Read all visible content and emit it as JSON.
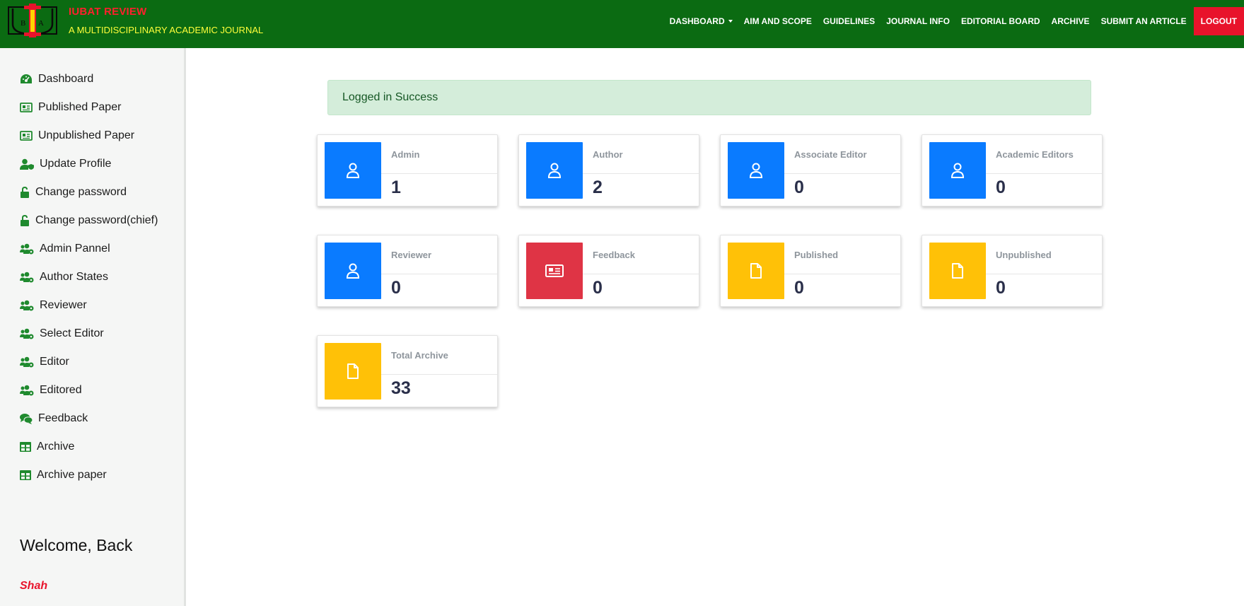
{
  "header": {
    "logo_letters": [
      "I",
      "U",
      "B",
      "A",
      "T"
    ],
    "title": "IUBAT REVIEW",
    "subtitle": "A MULTIDISCIPLINARY ACADEMIC JOURNAL",
    "nav": [
      {
        "label": "DASHBOARD",
        "dropdown": true
      },
      {
        "label": "AIM AND SCOPE"
      },
      {
        "label": "GUIDELINES"
      },
      {
        "label": "JOURNAL INFO"
      },
      {
        "label": "EDITORIAL BOARD"
      },
      {
        "label": "ARCHIVE"
      },
      {
        "label": "SUBMIT AN ARTICLE"
      }
    ],
    "logout_label": "LOGOUT"
  },
  "colors": {
    "header_bg": "#0b6b12",
    "brand_title": "#ff1f2d",
    "brand_sub": "#ffff3a",
    "logout_bg": "#e8132b",
    "sidebar_icon": "#1f8a2e",
    "blue": "#0a7bff",
    "red": "#df3445",
    "yellow": "#ffc107"
  },
  "sidebar": {
    "items": [
      {
        "label": "Dashboard",
        "icon": "tachometer-icon"
      },
      {
        "label": "Published Paper",
        "icon": "newspaper-icon"
      },
      {
        "label": "Unpublished Paper",
        "icon": "newspaper-icon"
      },
      {
        "label": "Update Profile",
        "icon": "user-shield-icon"
      },
      {
        "label": "Change password",
        "icon": "lock-open-icon"
      },
      {
        "label": "Change password(chief)",
        "icon": "lock-open-icon"
      },
      {
        "label": "Admin Pannel",
        "icon": "users-cog-icon"
      },
      {
        "label": "Author States",
        "icon": "users-cog-icon"
      },
      {
        "label": "Reviewer",
        "icon": "users-cog-icon"
      },
      {
        "label": "Select Editor",
        "icon": "users-cog-icon"
      },
      {
        "label": "Editor",
        "icon": "users-cog-icon"
      },
      {
        "label": "Editored",
        "icon": "users-cog-icon"
      },
      {
        "label": "Feedback",
        "icon": "comments-icon"
      },
      {
        "label": "Archive",
        "icon": "table-icon"
      },
      {
        "label": "Archive paper",
        "icon": "table-icon"
      }
    ],
    "welcome": "Welcome, Back",
    "username": "Shah"
  },
  "main": {
    "alert": "Logged in Success",
    "cards": [
      {
        "label": "Admin",
        "value": "1",
        "color": "blue",
        "icon": "user-icon"
      },
      {
        "label": "Author",
        "value": "2",
        "color": "blue",
        "icon": "user-icon"
      },
      {
        "label": "Associate Editor",
        "value": "0",
        "color": "blue",
        "icon": "user-icon"
      },
      {
        "label": "Academic Editors",
        "value": "0",
        "color": "blue",
        "icon": "user-icon"
      },
      {
        "label": "Reviewer",
        "value": "0",
        "color": "blue",
        "icon": "user-icon"
      },
      {
        "label": "Feedback",
        "value": "0",
        "color": "red",
        "icon": "newspaper-icon"
      },
      {
        "label": "Published",
        "value": "0",
        "color": "yellow",
        "icon": "file-icon"
      },
      {
        "label": "Unpublished",
        "value": "0",
        "color": "yellow",
        "icon": "file-icon"
      },
      {
        "label": "Total Archive",
        "value": "33",
        "color": "yellow",
        "icon": "file-icon"
      }
    ]
  }
}
